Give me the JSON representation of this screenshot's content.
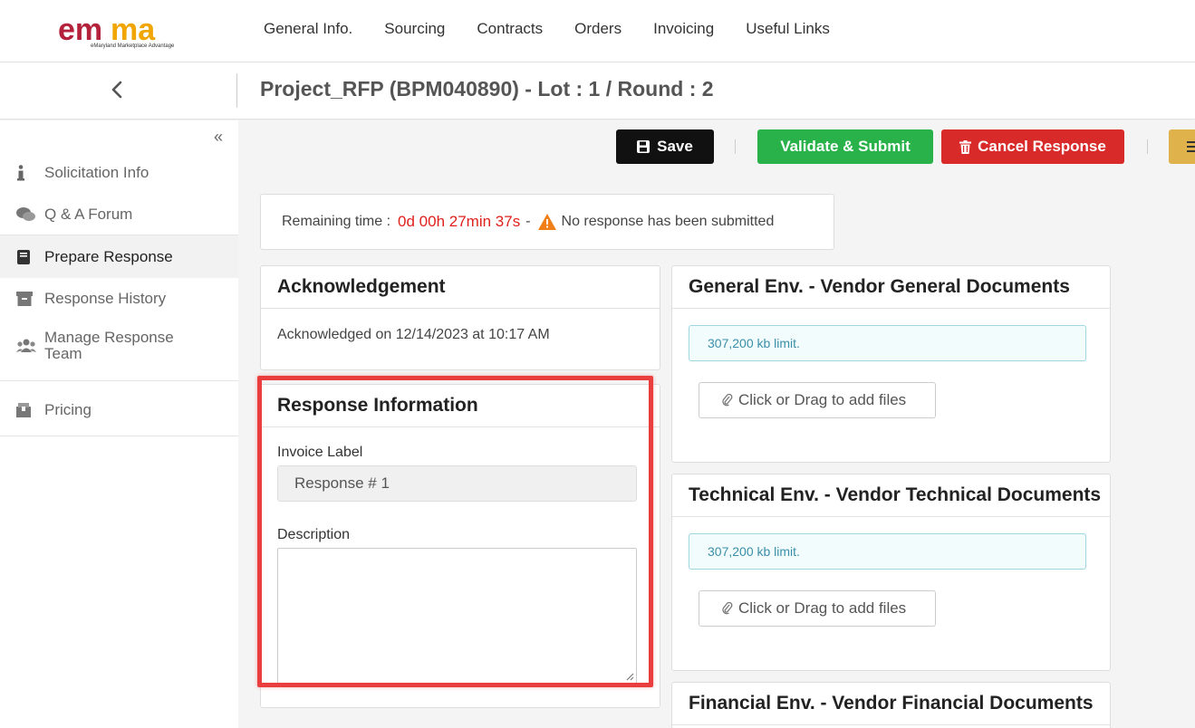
{
  "nav": {
    "logo_text": "emma",
    "logo_tagline": "eMaryland Marketplace Advantage",
    "items": [
      "General Info.",
      "Sourcing",
      "Contracts",
      "Orders",
      "Invoicing",
      "Useful Links"
    ]
  },
  "header": {
    "title": "Project_RFP (BPM040890) - Lot : 1 / Round : 2"
  },
  "sidebar": {
    "items": [
      {
        "label": "Solicitation Info",
        "icon": "info-icon"
      },
      {
        "label": "Q & A Forum",
        "icon": "comments-icon"
      },
      {
        "label": "Prepare Response",
        "icon": "book-icon"
      },
      {
        "label": "Response History",
        "icon": "archive-icon"
      },
      {
        "label": "Manage Response Team",
        "icon": "users-icon"
      },
      {
        "label": "Pricing",
        "icon": "box-icon"
      }
    ],
    "active": "Prepare Response"
  },
  "toolbar": {
    "save": "Save",
    "validate": "Validate & Submit",
    "cancel": "Cancel Response"
  },
  "status": {
    "remaining_label": "Remaining time :",
    "timer": "0d 00h 27min 37s",
    "separator": "-",
    "message": "No response has been submitted"
  },
  "acknowledgement": {
    "title": "Acknowledgement",
    "text": "Acknowledged on 12/14/2023 at 10:17 AM"
  },
  "response_info": {
    "title": "Response Information",
    "invoice_label": "Invoice Label",
    "invoice_value": "Response # 1",
    "description_label": "Description",
    "description_value": ""
  },
  "envelopes": [
    {
      "title": "General Env. - Vendor General Documents",
      "limit": "307,200 kb limit.",
      "add_files": "Click or Drag to add files"
    },
    {
      "title": "Technical Env. - Vendor Technical Documents",
      "limit": "307,200 kb limit.",
      "add_files": "Click or Drag to add files"
    },
    {
      "title": "Financial Env. - Vendor Financial Documents"
    }
  ],
  "colors": {
    "save": "#111111",
    "validate": "#2ab24a",
    "cancel": "#d92a2a",
    "timer": "#e0201c",
    "highlight": "#ea3e3e"
  }
}
